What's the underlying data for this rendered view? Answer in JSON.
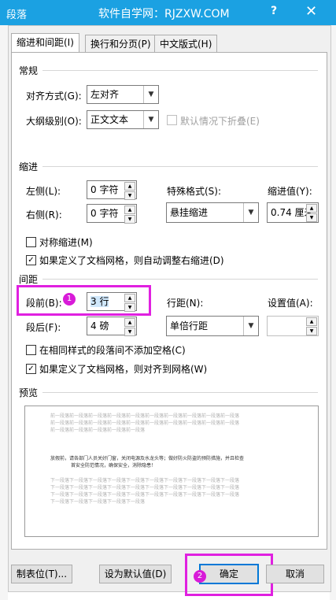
{
  "window": {
    "title": "段落",
    "watermark": "软件自学网：RJZXW.COM",
    "help": "?",
    "close": "✕"
  },
  "tabs": [
    {
      "label": "缩进和间距(I)"
    },
    {
      "label": "换行和分页(P)"
    },
    {
      "label": "中文版式(H)"
    }
  ],
  "general": {
    "heading": "常规",
    "alignment_label": "对齐方式(G):",
    "alignment_value": "左对齐",
    "outline_label": "大纲级别(O):",
    "outline_value": "正文文本",
    "collapse_label": "默认情况下折叠(E)"
  },
  "indent": {
    "heading": "缩进",
    "left_label": "左侧(L):",
    "left_value": "0 字符",
    "right_label": "右侧(R):",
    "right_value": "0 字符",
    "special_label": "特殊格式(S):",
    "special_value": "悬挂缩进",
    "by_label": "缩进值(Y):",
    "by_value": "0.74 厘米",
    "mirror_label": "对称缩进(M)",
    "auto_adjust_label": "如果定义了文档网格，则自动调整右缩进(D)"
  },
  "spacing": {
    "heading": "间距",
    "before_label": "段前(B):",
    "before_value": "3 行",
    "after_label": "段后(F):",
    "after_value": "4 磅",
    "line_label": "行距(N):",
    "line_value": "单倍行距",
    "at_label": "设置值(A):",
    "at_value": "",
    "no_space_label": "在相同样式的段落间不添加空格(C)",
    "snap_grid_label": "如果定义了文档网格，则对齐到网格(W)"
  },
  "preview": {
    "heading": "预览",
    "prev_lines": [
      "前一段落前一段落前一段落前一段落前一段落前一段落前一段落前一段落前一段落前一段落",
      "前一段落前一段落前一段落前一段落前一段落前一段落前一段落前一段落前一段落前一段落",
      "前一段落前一段落前一段落前一段落前一段落"
    ],
    "sample_lines": [
      "放假前，请各部门人员关好门窗，关闭电源及水龙头等；做好防火防盗的预防措施，并且检查",
      "首安全防范情况，确保安全，消除隐患！"
    ],
    "next_lines": [
      "下一段落下一段落下一段落下一段落下一段落下一段落下一段落下一段落下一段落下一段落",
      "下一段落下一段落下一段落下一段落下一段落下一段落下一段落下一段落下一段落下一段落",
      "下一段落下一段落下一段落下一段落下一段落下一段落下一段落下一段落下一段落下一段落",
      "下一段落下一段落下一段落下一段落下一段落"
    ]
  },
  "buttons": {
    "tabs": "制表位(T)...",
    "set_default": "设为默认值(D)",
    "ok": "确定",
    "cancel": "取消"
  },
  "callouts": {
    "one": "1",
    "two": "2"
  },
  "colors": {
    "title_bar": "#1ba1e2",
    "callout": "#e020e0"
  }
}
